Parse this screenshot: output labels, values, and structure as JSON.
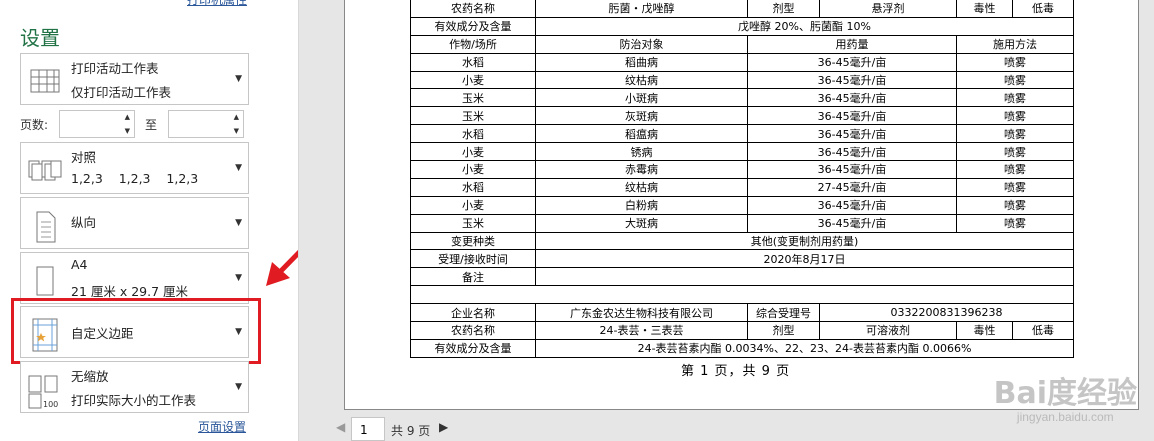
{
  "panel": {
    "top_link": "打印机属性",
    "title": "设置",
    "print_what": {
      "line1": "打印活动工作表",
      "line2": "仅打印活动工作表"
    },
    "pages": {
      "label": "页数:",
      "to": "至",
      "from_value": "",
      "to_value": ""
    },
    "collate": {
      "line1": "对照",
      "line2": "1,2,3    1,2,3    1,2,3"
    },
    "orientation": {
      "line1": "纵向"
    },
    "paper": {
      "line1": "A4",
      "line2": "21 厘米 x 29.7 厘米"
    },
    "margins": {
      "line1": "自定义边距"
    },
    "scaling": {
      "line1": "无缩放",
      "line2": "打印实际大小的工作表"
    },
    "page_setup_link": "页面设置"
  },
  "preview": {
    "rows1": [
      [
        "农药名称",
        "肟菌・戊唑醇",
        "剂型",
        "悬浮剂",
        "毒性",
        "低毒"
      ],
      [
        "有效成分及含量",
        "戊唑醇 20%、肟菌酯 10%"
      ],
      [
        "作物/场所",
        "防治对象",
        "用药量",
        "施用方法"
      ],
      [
        "水稻",
        "稻曲病",
        "36-45毫升/亩",
        "喷雾"
      ],
      [
        "小麦",
        "纹枯病",
        "36-45毫升/亩",
        "喷雾"
      ],
      [
        "玉米",
        "小斑病",
        "36-45毫升/亩",
        "喷雾"
      ],
      [
        "玉米",
        "灰斑病",
        "36-45毫升/亩",
        "喷雾"
      ],
      [
        "水稻",
        "稻瘟病",
        "36-45毫升/亩",
        "喷雾"
      ],
      [
        "小麦",
        "锈病",
        "36-45毫升/亩",
        "喷雾"
      ],
      [
        "小麦",
        "赤霉病",
        "36-45毫升/亩",
        "喷雾"
      ],
      [
        "水稻",
        "纹枯病",
        "27-45毫升/亩",
        "喷雾"
      ],
      [
        "小麦",
        "白粉病",
        "36-45毫升/亩",
        "喷雾"
      ],
      [
        "玉米",
        "大斑病",
        "36-45毫升/亩",
        "喷雾"
      ]
    ],
    "change_type": {
      "label": "变更种类",
      "value": "其他(变更制剂用药量)"
    },
    "accept_time": {
      "label": "受理/接收时间",
      "value": "2020年8月17日"
    },
    "remark": {
      "label": "备注",
      "value": ""
    },
    "company": {
      "label": "企业名称",
      "value": "广东金农达生物科技有限公司",
      "acc_label": "综合受理号",
      "acc_value": "0332200831396238"
    },
    "pest2": [
      "农药名称",
      "24-表芸・三表芸",
      "剂型",
      "可溶液剂",
      "毒性",
      "低毒"
    ],
    "ingr2": {
      "label": "有效成分及含量",
      "value": "24-表芸苔素内酯 0.0034%、22、23、24-表芸苔素内酯 0.0066%"
    },
    "footer": "第 1 页，共 9 页"
  },
  "nav": {
    "page": "1",
    "total": "共 9 页"
  },
  "watermark": {
    "logo": "Bai度经验",
    "url": "jingyan.baidu.com"
  },
  "colors": {
    "accent": "#217346",
    "highlight": "#e01b22",
    "link": "#2b579a"
  }
}
